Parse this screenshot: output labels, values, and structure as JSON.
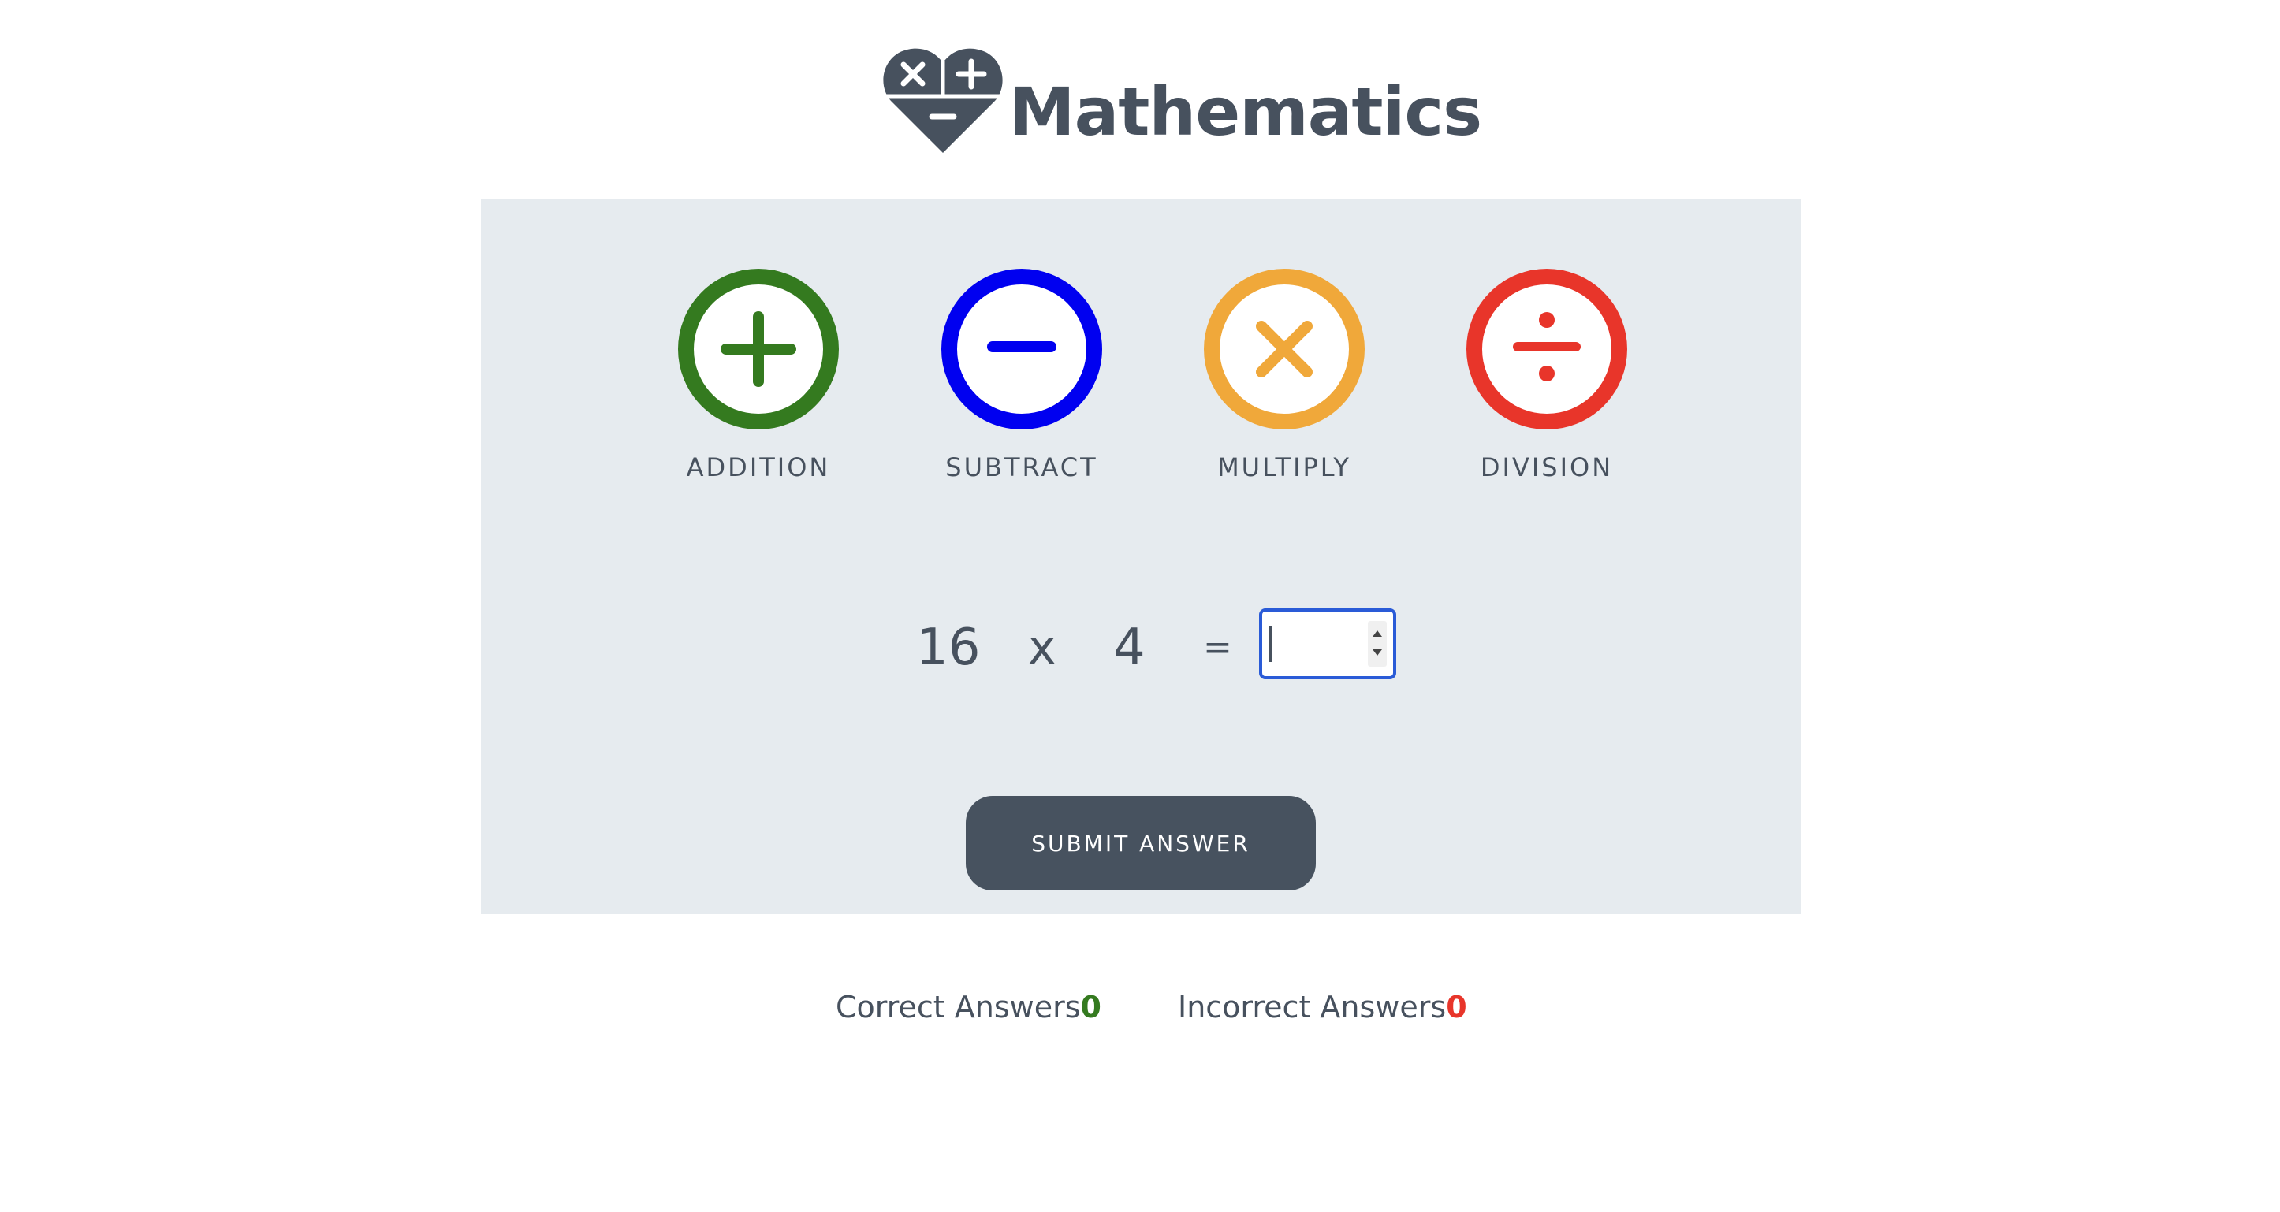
{
  "header": {
    "title": "Mathematics",
    "logo_icon": "math-heart-logo-icon"
  },
  "operations": [
    {
      "label": "ADDITION",
      "icon": "plus-circle-icon",
      "color": "#347a1f"
    },
    {
      "label": "SUBTRACT",
      "icon": "minus-circle-icon",
      "color": "#0000f0"
    },
    {
      "label": "MULTIPLY",
      "icon": "times-circle-icon",
      "color": "#f0a83a"
    },
    {
      "label": "DIVISION",
      "icon": "divide-circle-icon",
      "color": "#e8352a"
    }
  ],
  "equation": {
    "left_operand": "16",
    "operator": "x",
    "right_operand": "4",
    "equals": "=",
    "answer_value": ""
  },
  "submit": {
    "label": "SUBMIT ANSWER"
  },
  "scores": {
    "correct_label": "Correct Answers",
    "correct_count": "0",
    "correct_color": "#347a1f",
    "incorrect_label": "Incorrect Answers",
    "incorrect_count": "0",
    "incorrect_color": "#e8352a"
  }
}
